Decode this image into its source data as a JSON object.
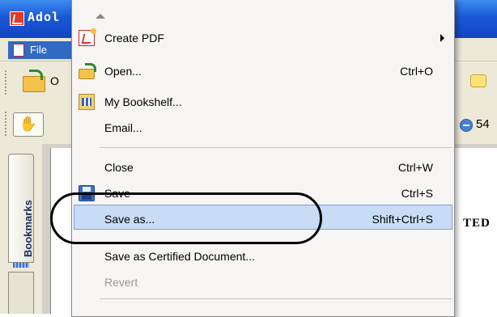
{
  "app": {
    "title": "Adol",
    "menubar": {
      "file_label": "File"
    },
    "toolbar": {
      "open_partial": "O",
      "zoom_partial": "54"
    },
    "side_tab": {
      "bookmarks_label": "Bookmarks"
    },
    "document": {
      "visible_text": "TED"
    }
  },
  "file_menu": {
    "items": [
      {
        "label": "Create PDF",
        "icon": "create-pdf-icon",
        "has_submenu": true,
        "shortcut": ""
      },
      {
        "label": "Open...",
        "icon": "open-folder-icon",
        "shortcut": "Ctrl+O"
      },
      {
        "label": "My Bookshelf...",
        "icon": "bookshelf-icon",
        "shortcut": ""
      },
      {
        "label": "Email...",
        "icon": "",
        "shortcut": ""
      },
      {
        "label": "Close",
        "icon": "",
        "shortcut": "Ctrl+W"
      },
      {
        "label": "Save",
        "icon": "save-disk-icon",
        "shortcut": "Ctrl+S"
      },
      {
        "label": "Save as...",
        "icon": "",
        "shortcut": "Shift+Ctrl+S",
        "highlighted": true
      },
      {
        "label": "Save as Certified Document...",
        "icon": "",
        "shortcut": ""
      },
      {
        "label": "Revert",
        "icon": "",
        "shortcut": "",
        "disabled": true
      }
    ]
  },
  "colors": {
    "title_bar": "#1a58d6",
    "highlight": "#c9dcf5",
    "callout": "#000000"
  }
}
